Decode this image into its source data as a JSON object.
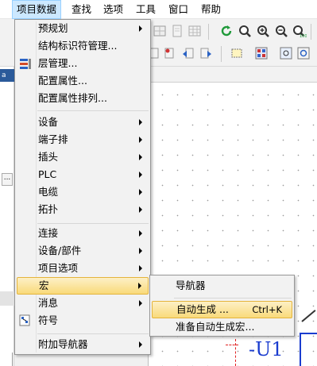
{
  "menubar": {
    "items": [
      "项目数据",
      "查找",
      "选项",
      "工具",
      "窗口",
      "帮助"
    ]
  },
  "project_menu": {
    "items": [
      {
        "label": "预规划",
        "submenu": true
      },
      {
        "label": "结构标识符管理...",
        "submenu": false
      },
      {
        "label": "层管理...",
        "submenu": false,
        "icon": "layer-manager-icon"
      },
      {
        "label": "配置属性...",
        "submenu": false
      },
      {
        "label": "配置属性排列...",
        "submenu": false
      },
      {
        "label": "设备",
        "submenu": true
      },
      {
        "label": "端子排",
        "submenu": true
      },
      {
        "label": "插头",
        "submenu": true
      },
      {
        "label": "PLC",
        "submenu": true
      },
      {
        "label": "电缆",
        "submenu": true
      },
      {
        "label": "拓扑",
        "submenu": true
      },
      {
        "label": "连接",
        "submenu": true
      },
      {
        "label": "设备/部件",
        "submenu": true
      },
      {
        "label": "项目选项",
        "submenu": true
      },
      {
        "label": "宏",
        "submenu": true,
        "highlighted": true
      },
      {
        "label": "消息",
        "submenu": true
      },
      {
        "label": "符号",
        "submenu": false,
        "icon": "symbol-icon"
      },
      {
        "label": "附加导航器",
        "submenu": true
      }
    ]
  },
  "macro_submenu": {
    "items": [
      {
        "label": "导航器",
        "shortcut": ""
      },
      {
        "label": "自动生成 ...",
        "shortcut": "Ctrl+K",
        "highlighted": true
      },
      {
        "label": "准备自动生成宏...",
        "shortcut": ""
      }
    ]
  },
  "left_panel": {
    "header_text": "a",
    "button_text": "..."
  },
  "canvas": {
    "component_label": "-U1"
  },
  "colors": {
    "highlight": "#f9da7a",
    "menu_bg": "#f2f2f2",
    "canvas_dash": "#e02020",
    "component_blue": "#1a3ccf"
  }
}
